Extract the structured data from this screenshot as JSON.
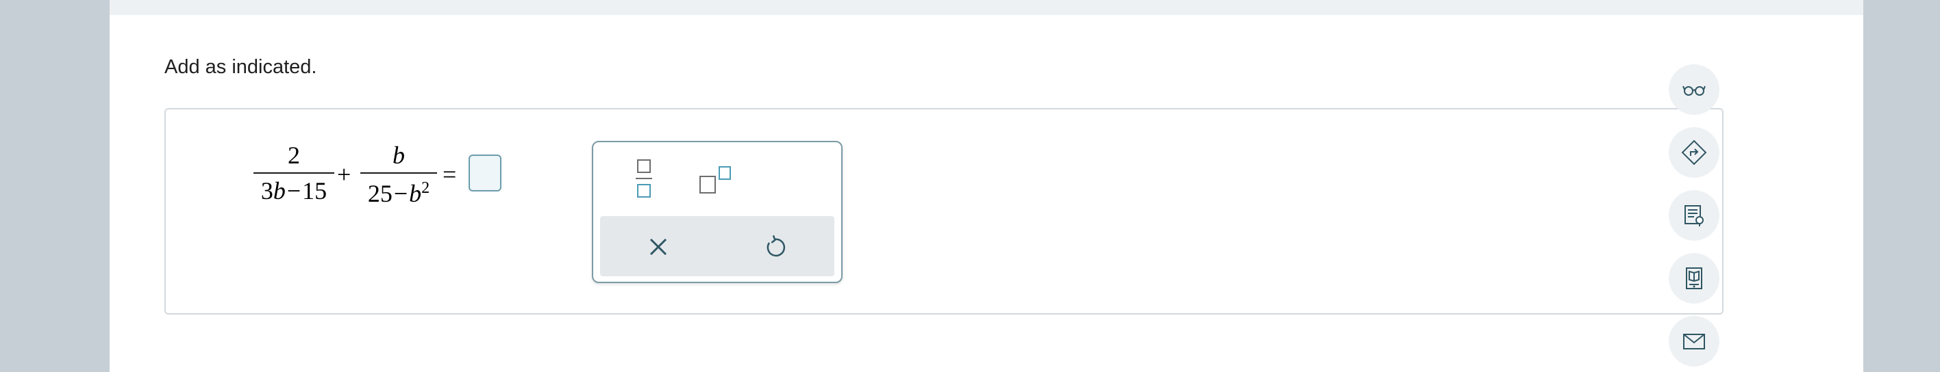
{
  "instruction": "Add as indicated.",
  "expression": {
    "term1": {
      "numerator": "2",
      "den_a": "3",
      "den_b": "b",
      "den_minus": "−",
      "den_c": "15"
    },
    "plus": "+",
    "term2": {
      "numerator": "b",
      "den_a": "25",
      "den_minus": "−",
      "den_b": "b",
      "den_exp": "2"
    },
    "equals": "="
  },
  "answer": {
    "value": ""
  },
  "palette": {
    "tools": [
      "fraction-template",
      "exponent-template"
    ],
    "actions": [
      "clear",
      "undo"
    ]
  },
  "sidebar": {
    "tools": [
      "view-example",
      "help-me-solve",
      "textbook",
      "calculator",
      "message-instructor"
    ]
  },
  "colors": {
    "accent": "#4a9bb5",
    "icon": "#2f5663",
    "page_bg": "#c6cfd6",
    "side_btn_bg": "#eef1f3"
  }
}
